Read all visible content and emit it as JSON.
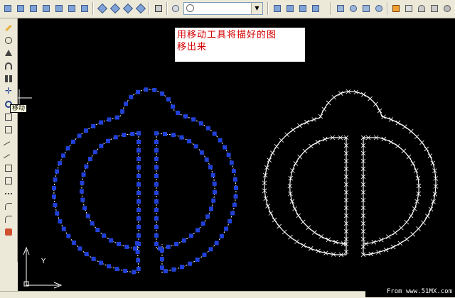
{
  "toolbar": {
    "buttons": [
      "view-top",
      "view-bottom",
      "view-left",
      "view-right",
      "view-front",
      "view-back",
      "iso-sw",
      "iso-se",
      "iso-ne",
      "iso-nw",
      "named-views",
      "orbit",
      "pan-3d",
      "zoom-3d",
      "free-orbit",
      "render",
      "shade",
      "flat-shade",
      "gouraud"
    ]
  },
  "left_toolbar": {
    "tools": [
      "erase",
      "copy",
      "mirror",
      "offset",
      "array",
      "move",
      "rotate",
      "scale",
      "stretch",
      "trim",
      "extend",
      "break",
      "chamfer",
      "fillet",
      "explode"
    ]
  },
  "annotation": {
    "line1": "用移动工具将描好的图",
    "line2": "移出来"
  },
  "tooltip": {
    "text": "移动"
  },
  "axes": {
    "y_label": "Y",
    "x_label": "X"
  },
  "watermark": {
    "prefix": "From",
    "site": "www.51MX.com"
  },
  "colors": {
    "canvas_bg": "#000000",
    "grip_blue": "#2040d8",
    "outline_white": "#ffffff",
    "note_text": "#d40000"
  }
}
